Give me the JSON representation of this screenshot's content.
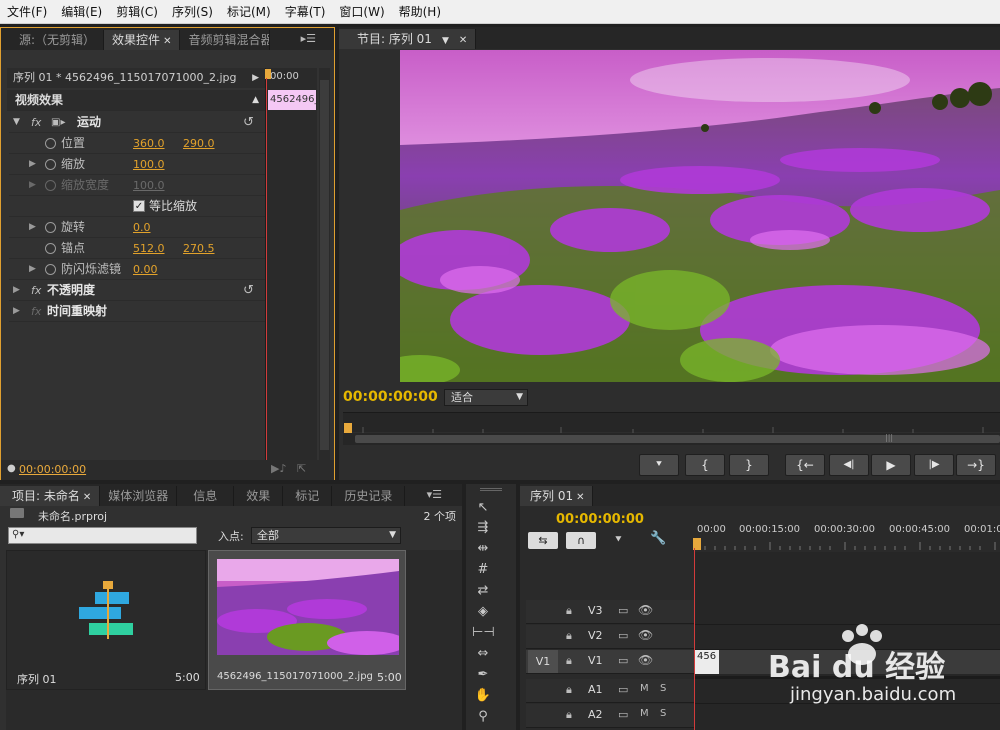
{
  "menu": [
    "文件(F)",
    "编辑(E)",
    "剪辑(C)",
    "序列(S)",
    "标记(M)",
    "字幕(T)",
    "窗口(W)",
    "帮助(H)"
  ],
  "source_panel": {
    "tabs": [
      "源:（无剪辑）",
      "效果控件",
      "音频剪辑混合器"
    ],
    "clip_header": "序列 01 * 4562496_115017071000_2.jpg",
    "mini_time": "00:00",
    "clip_chip": "4562496_",
    "section_title": "视频效果",
    "motion": "运动",
    "position_label": "位置",
    "position_x": "360.0",
    "position_y": "290.0",
    "scale_label": "缩放",
    "scale_value": "100.0",
    "scale_width_label": "缩放宽度",
    "scale_width_value": "100.0",
    "uniform_label": "等比缩放",
    "rotation_label": "旋转",
    "rotation_value": "0.0",
    "anchor_label": "锚点",
    "anchor_x": "512.0",
    "anchor_y": "270.5",
    "flicker_label": "防闪烁滤镜",
    "flicker_value": "0.00",
    "opacity": "不透明度",
    "time_remap": "时间重映射",
    "bottom_time": "00:00:00:00"
  },
  "program_panel": {
    "tab": "节目: 序列 01",
    "timecode": "00:00:00:00",
    "fit": "适合",
    "buttons": [
      "⯆",
      "{",
      "}",
      "{←",
      "◀|",
      "▶",
      "|▶",
      "→}"
    ]
  },
  "project_panel": {
    "tabs": [
      "项目: 未命名",
      "媒体浏览器",
      "信息",
      "效果",
      "标记",
      "历史记录"
    ],
    "project_file": "未命名.prproj",
    "count": "2 个项",
    "in_point_label": "入点:",
    "in_point_value": "全部",
    "items": [
      {
        "name": "序列 01",
        "duration": "5:00"
      },
      {
        "name": "4562496_115017071000_2.jpg",
        "duration": "5:00"
      }
    ]
  },
  "timeline": {
    "tab": "序列 01",
    "timecode": "00:00:00:00",
    "ruler": [
      "00:00",
      "00:00:15:00",
      "00:00:30:00",
      "00:00:45:00",
      "00:01:0"
    ],
    "tracks": [
      {
        "src": "",
        "name": "V3",
        "type": "video"
      },
      {
        "src": "",
        "name": "V2",
        "type": "video"
      },
      {
        "src": "V1",
        "name": "V1",
        "type": "video"
      },
      {
        "src": "",
        "name": "A1",
        "type": "audio"
      },
      {
        "src": "",
        "name": "A2",
        "type": "audio"
      }
    ],
    "clip_label": "456"
  },
  "watermark": {
    "brand": "Bai du 经验",
    "url": "jingyan.baidu.com"
  },
  "colors": {
    "accent": "#e8a93c",
    "panel": "#333333",
    "playhead": "#d23b3b"
  }
}
